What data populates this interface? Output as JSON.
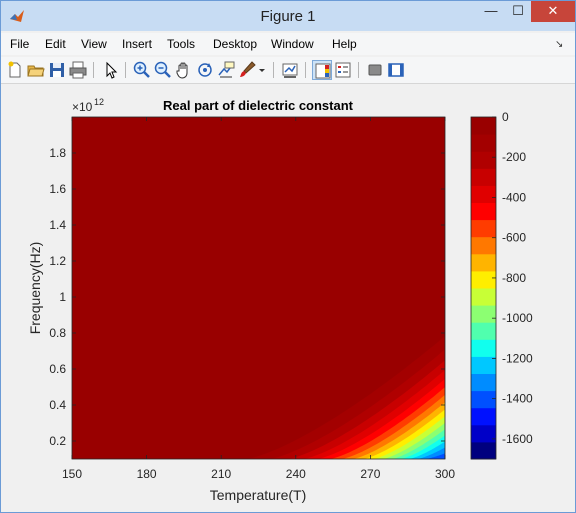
{
  "window": {
    "title": "Figure 1",
    "minimize_glyph": "—",
    "maximize_glyph": "☐",
    "close_glyph": "✕",
    "dock_glyph": "↘"
  },
  "menubar": {
    "items": [
      "File",
      "Edit",
      "View",
      "Insert",
      "Tools",
      "Desktop",
      "Window",
      "Help"
    ]
  },
  "toolbar": {
    "buttons": [
      "new-figure-icon",
      "open-file-icon",
      "save-icon",
      "print-icon",
      "edit-plot-arrow-icon",
      "zoom-in-icon",
      "zoom-out-icon",
      "pan-hand-icon",
      "rotate-3d-icon",
      "data-cursor-icon",
      "brush-icon",
      "brush-dropdown-icon",
      "link-plot-icon",
      "colorbar-toggle-icon",
      "legend-toggle-icon",
      "hide-plot-tools-icon",
      "show-plot-tools-icon"
    ],
    "active_button": "colorbar-toggle-icon"
  },
  "chart_data": {
    "type": "heatmap",
    "title": "Real part of dielectric constant",
    "xlabel": "Temperature(T)",
    "ylabel": "Frequency(Hz)",
    "x_ticks": [
      "150",
      "180",
      "210",
      "240",
      "270",
      "300"
    ],
    "y_ticks": [
      "0.2",
      "0.4",
      "0.6",
      "0.8",
      "1",
      "1.2",
      "1.4",
      "1.6",
      "1.8"
    ],
    "y_exponent_label": "×10",
    "y_exponent_power": "12",
    "xlim": [
      150,
      300
    ],
    "ylim": [
      100000000000.0,
      2000000000000.0
    ],
    "colorbar": {
      "ticks": [
        "0",
        "-200",
        "-400",
        "-600",
        "-800",
        "-1000",
        "-1200",
        "-1400",
        "-1600"
      ],
      "range": [
        -1700,
        0
      ],
      "levels": 20,
      "colors": [
        "#00007f",
        "#0000c8",
        "#0011ff",
        "#0050ff",
        "#008cff",
        "#00c8ff",
        "#11ffee",
        "#50ffae",
        "#8cff72",
        "#c8ff36",
        "#ffee00",
        "#ffb400",
        "#ff7800",
        "#ff3c00",
        "#ff0000",
        "#e00000",
        "#c80000",
        "#b00000",
        "#a30000",
        "#990000"
      ]
    },
    "contour_boundaries_note_levels": [
      0,
      -100,
      -200,
      -300,
      -400,
      -500,
      -600,
      -700,
      -800,
      -900,
      -1000,
      -1100,
      -1200,
      -1300,
      -1400,
      -1500,
      -1600,
      -1700
    ]
  }
}
